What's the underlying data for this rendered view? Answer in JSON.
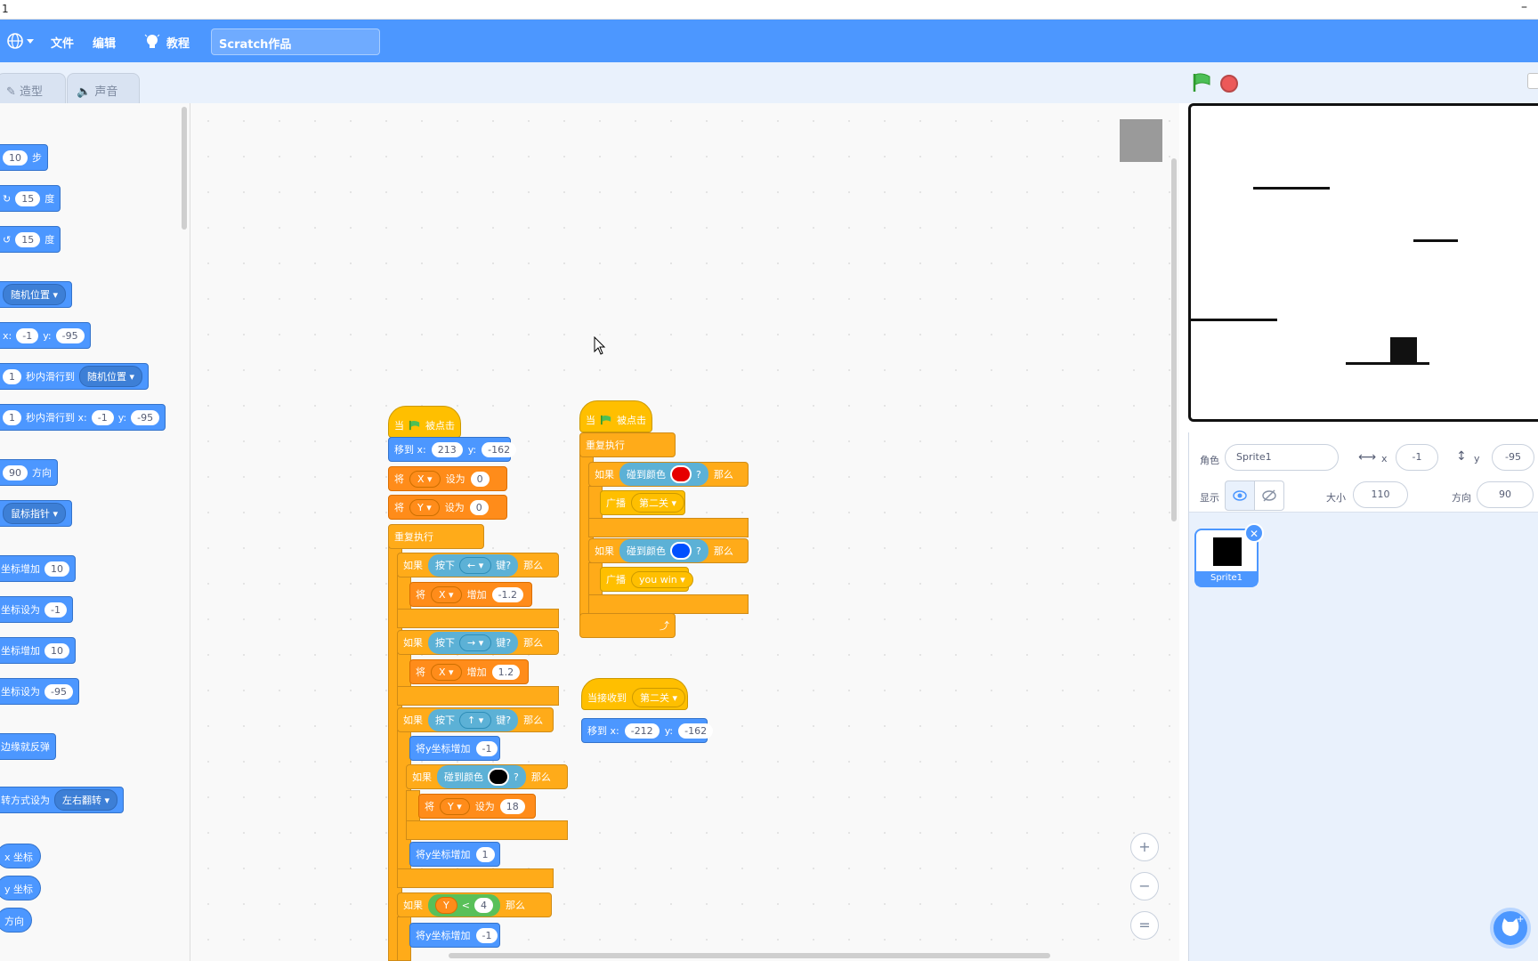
{
  "window": {
    "title": "1",
    "minimize": "–"
  },
  "menubar": {
    "file": "文件",
    "edit": "编辑",
    "tutorials": "教程",
    "project_title": "Scratch作品"
  },
  "tabs": {
    "costumes": "造型",
    "sounds": "声音"
  },
  "palette": {
    "move_steps": "10",
    "move_unit": "步",
    "turn_right": "15",
    "turn_right_unit": "度",
    "turn_left": "15",
    "turn_left_unit": "度",
    "goto_target": "随机位置",
    "goto_x_label": "x:",
    "goto_x": "-1",
    "goto_y_label": "y:",
    "goto_y": "-95",
    "glide_secs": "1",
    "glide_label": "秒内滑行到",
    "glide_target": "随机位置",
    "glide2_secs": "1",
    "glide2_label": "秒内滑行到 x:",
    "glide2_x": "-1",
    "glide2_y_label": "y:",
    "glide2_y": "-95",
    "point_dir": "90",
    "point_label": "方向",
    "point_towards": "鼠标指针",
    "change_x_label": "坐标增加",
    "change_x": "10",
    "set_x_label": "坐标设为",
    "set_x": "-1",
    "change_y_label": "坐标增加",
    "change_y": "10",
    "set_y_label": "坐标设为",
    "set_y": "-95",
    "bounce": "边缘就反弹",
    "rotation_label": "转方式设为",
    "rotation_style": "左右翻转",
    "rep_x": "x 坐标",
    "rep_y": "y 坐标",
    "rep_dir": "方向"
  },
  "script1": {
    "when": "当",
    "flag_clicked": "被点击",
    "goto_label": "移到 x:",
    "goto_x": "213",
    "goto_y_label": "y:",
    "goto_y": "-162",
    "set_word": "将",
    "var_x": "X",
    "set_to": "设为",
    "set_x_val": "0",
    "var_y": "Y",
    "set_y_val": "0",
    "forever": "重复执行",
    "if_word": "如果",
    "key_pressed": "按下",
    "key_suffix": "键?",
    "then": "那么",
    "key_left": "←",
    "change_by": "增加",
    "left_val": "-1.2",
    "key_right": "→",
    "right_val": "1.2",
    "key_up": "↑",
    "change_y_label": "将y坐标增加",
    "change_y_neg": "-1",
    "touch_color": "碰到颜色",
    "q": "?",
    "set_y_18": "18",
    "change_y_pos": "1",
    "lt": "<",
    "lt_val": "4",
    "change_y_neg2": "-1"
  },
  "script2": {
    "when": "当",
    "flag_clicked": "被点击",
    "forever": "重复执行",
    "if_word": "如果",
    "touch_color": "碰到颜色",
    "q": "?",
    "then": "那么",
    "broadcast": "广播",
    "msg1": "第二关",
    "msg2": "you win",
    "loop_arrow": "⤴"
  },
  "script3": {
    "when_receive": "当接收到",
    "msg": "第二关",
    "goto_label": "移到 x:",
    "goto_x": "-212",
    "goto_y_label": "y:",
    "goto_y": "-162"
  },
  "zoom": {
    "in": "+",
    "out": "−",
    "reset": "="
  },
  "sprite_info": {
    "sprite_label": "角色",
    "sprite_name": "Sprite1",
    "x_label": "x",
    "x_val": "-1",
    "y_label": "y",
    "y_val": "-95",
    "show_label": "显示",
    "size_label": "大小",
    "size_val": "110",
    "dir_label": "方向",
    "dir_val": "90"
  },
  "sprite_tile": {
    "name": "Sprite1",
    "delete": "✕"
  },
  "colors": {
    "menu_blue": "#4c97ff",
    "motion": "#4c97ff",
    "event": "#ffbf00",
    "control": "#ffab19",
    "variable": "#ff8c1a",
    "sensing": "#5cb1d6",
    "operator": "#59c059",
    "touch_red": "#e60000",
    "touch_blue": "#0050ff",
    "touch_black": "#000000"
  }
}
